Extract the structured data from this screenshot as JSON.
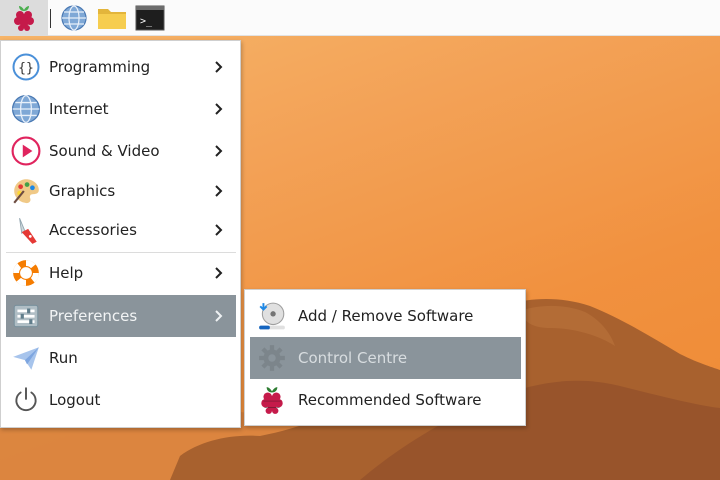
{
  "taskbar": {
    "buttons": [
      {
        "name": "raspberry-menu-button",
        "icon": "raspberry-icon"
      },
      {
        "name": "web-browser-launcher",
        "icon": "globe-icon"
      },
      {
        "name": "file-manager-launcher",
        "icon": "folder-icon"
      },
      {
        "name": "terminal-launcher",
        "icon": "terminal-icon",
        "glyph": ">_"
      }
    ]
  },
  "menu": {
    "items": [
      {
        "label": "Programming",
        "icon": "programming-braces-icon",
        "has_submenu": true
      },
      {
        "label": "Internet",
        "icon": "globe-icon",
        "has_submenu": true
      },
      {
        "label": "Sound & Video",
        "icon": "play-icon",
        "has_submenu": true
      },
      {
        "label": "Graphics",
        "icon": "palette-icon",
        "has_submenu": true
      },
      {
        "label": "Accessories",
        "icon": "pocket-knife-icon",
        "has_submenu": true
      },
      {
        "label": "Help",
        "icon": "lifebuoy-icon",
        "has_submenu": true
      },
      {
        "label": "Preferences",
        "icon": "preferences-icon",
        "has_submenu": true,
        "highlighted": true
      },
      {
        "label": "Run",
        "icon": "paper-plane-icon",
        "has_submenu": false
      },
      {
        "label": "Logout",
        "icon": "power-icon",
        "has_submenu": false
      }
    ]
  },
  "submenu": {
    "parent": "Preferences",
    "items": [
      {
        "label": "Add / Remove Software",
        "icon": "software-install-icon"
      },
      {
        "label": "Control Centre",
        "icon": "gear-icon",
        "highlighted": true
      },
      {
        "label": "Recommended Software",
        "icon": "raspberry-icon"
      }
    ]
  },
  "colors": {
    "highlight": "#8a949b",
    "desktop_orange": "#f3a257",
    "rock_brown": "#a8612e"
  }
}
